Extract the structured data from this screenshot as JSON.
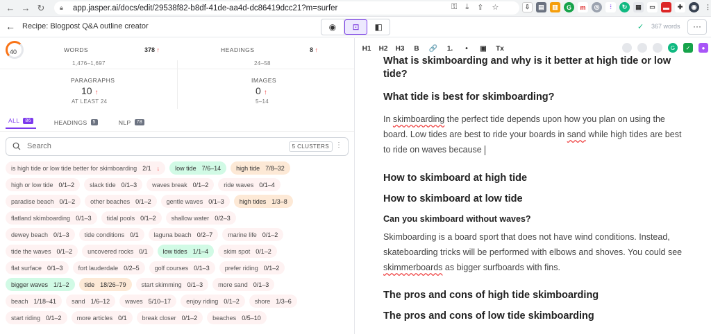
{
  "browser": {
    "url": "app.jasper.ai/docs/edit/29538f82-b8df-41de-aa4d-dc86419dcc21?m=surfer"
  },
  "app": {
    "title": "Recipe: Blogpost Q&A outline creator",
    "word_count": "367 words"
  },
  "score": {
    "value": "40"
  },
  "metrics": {
    "words": {
      "label": "WORDS",
      "value": "378",
      "range": "1,476–1,697"
    },
    "headings": {
      "label": "HEADINGS",
      "value": "8",
      "range": "24–58"
    },
    "paragraphs": {
      "label": "PARAGRAPHS",
      "value": "10",
      "range": "AT LEAST 24"
    },
    "images": {
      "label": "IMAGES",
      "value": "0",
      "range": "5–14"
    }
  },
  "tabs": [
    {
      "label": "ALL",
      "count": "86"
    },
    {
      "label": "HEADINGS",
      "count": "5"
    },
    {
      "label": "NLP",
      "count": "78"
    }
  ],
  "search": {
    "placeholder": "Search",
    "clusters": "5 CLUSTERS"
  },
  "keywords": [
    [
      {
        "term": "is high tide or low tide better for skimboarding",
        "count": "2/1",
        "color": "red",
        "down": "↓"
      },
      {
        "term": "low tide",
        "count": "7/6–14",
        "color": "green"
      },
      {
        "term": "high tide",
        "count": "7/8–32",
        "color": "orange"
      }
    ],
    [
      {
        "term": "high or low tide",
        "count": "0/1–2",
        "color": "red"
      },
      {
        "term": "slack tide",
        "count": "0/1–3",
        "color": "red"
      },
      {
        "term": "waves break",
        "count": "0/1–2",
        "color": "red"
      },
      {
        "term": "ride waves",
        "count": "0/1–4",
        "color": "red"
      }
    ],
    [
      {
        "term": "paradise beach",
        "count": "0/1–2",
        "color": "red"
      },
      {
        "term": "other beaches",
        "count": "0/1–2",
        "color": "red"
      },
      {
        "term": "gentle waves",
        "count": "0/1–3",
        "color": "red"
      },
      {
        "term": "high tides",
        "count": "1/3–8",
        "color": "orange"
      }
    ],
    [
      {
        "term": "flatland skimboarding",
        "count": "0/1–3",
        "color": "red"
      },
      {
        "term": "tidal pools",
        "count": "0/1–2",
        "color": "red"
      },
      {
        "term": "shallow water",
        "count": "0/2–3",
        "color": "red"
      }
    ],
    [
      {
        "term": "dewey beach",
        "count": "0/1–3",
        "color": "red"
      },
      {
        "term": "tide conditions",
        "count": "0/1",
        "color": "red"
      },
      {
        "term": "laguna beach",
        "count": "0/2–7",
        "color": "red"
      },
      {
        "term": "marine life",
        "count": "0/1–2",
        "color": "red"
      }
    ],
    [
      {
        "term": "tide the waves",
        "count": "0/1–2",
        "color": "red"
      },
      {
        "term": "uncovered rocks",
        "count": "0/1",
        "color": "red"
      },
      {
        "term": "low tides",
        "count": "1/1–4",
        "color": "green"
      },
      {
        "term": "skim spot",
        "count": "0/1–2",
        "color": "red"
      }
    ],
    [
      {
        "term": "flat surface",
        "count": "0/1–3",
        "color": "red"
      },
      {
        "term": "fort lauderdale",
        "count": "0/2–5",
        "color": "red"
      },
      {
        "term": "golf courses",
        "count": "0/1–3",
        "color": "red"
      },
      {
        "term": "prefer riding",
        "count": "0/1–2",
        "color": "red"
      }
    ],
    [
      {
        "term": "bigger waves",
        "count": "1/1–2",
        "color": "green"
      },
      {
        "term": "tide",
        "count": "18/26–79",
        "color": "orange"
      },
      {
        "term": "start skimming",
        "count": "0/1–3",
        "color": "red"
      },
      {
        "term": "more sand",
        "count": "0/1–3",
        "color": "red"
      }
    ],
    [
      {
        "term": "beach",
        "count": "1/18–41",
        "color": "red"
      },
      {
        "term": "sand",
        "count": "1/6–12",
        "color": "red"
      },
      {
        "term": "waves",
        "count": "5/10–17",
        "color": "red"
      },
      {
        "term": "enjoy riding",
        "count": "0/1–2",
        "color": "red"
      },
      {
        "term": "shore",
        "count": "1/3–6",
        "color": "red"
      }
    ],
    [
      {
        "term": "start riding",
        "count": "0/1–2",
        "color": "red"
      },
      {
        "term": "more articles",
        "count": "0/1",
        "color": "red"
      },
      {
        "term": "break closer",
        "count": "0/1–2",
        "color": "red"
      },
      {
        "term": "beaches",
        "count": "0/5–10",
        "color": "red"
      }
    ]
  ],
  "toolbar": [
    "H1",
    "H2",
    "H3",
    "B",
    "🔗",
    "1.",
    "•",
    "▣",
    "Tx"
  ],
  "editor": {
    "h_top": "What is skimboarding and why is it better at high tide or low tide?",
    "h_tide": "What tide is best for skimboarding?",
    "p1_a": "In ",
    "p1_b": "skimboarding",
    "p1_c": " the perfect tide depends upon how you plan on using the board. Low tides are best to ride your boards in ",
    "p1_d": "sand",
    "p1_e": " while high tides are best to ride on waves because ",
    "h_high": "How to skimboard at high tide",
    "h_low": "How to skimboard at low tide",
    "h_without": "Can you skimboard without waves?",
    "p2_a": "Skimboarding is a board sport that does not have wind conditions. Instead, skateboarding tricks will be performed with elbows and shoves. You could see ",
    "p2_b": "skimmerboards",
    "p2_c": " as bigger surfboards with fins.",
    "h_pros_high": "The pros and cons of high tide skimboarding",
    "h_pros_low": "The pros and cons of low tide skimboarding"
  }
}
